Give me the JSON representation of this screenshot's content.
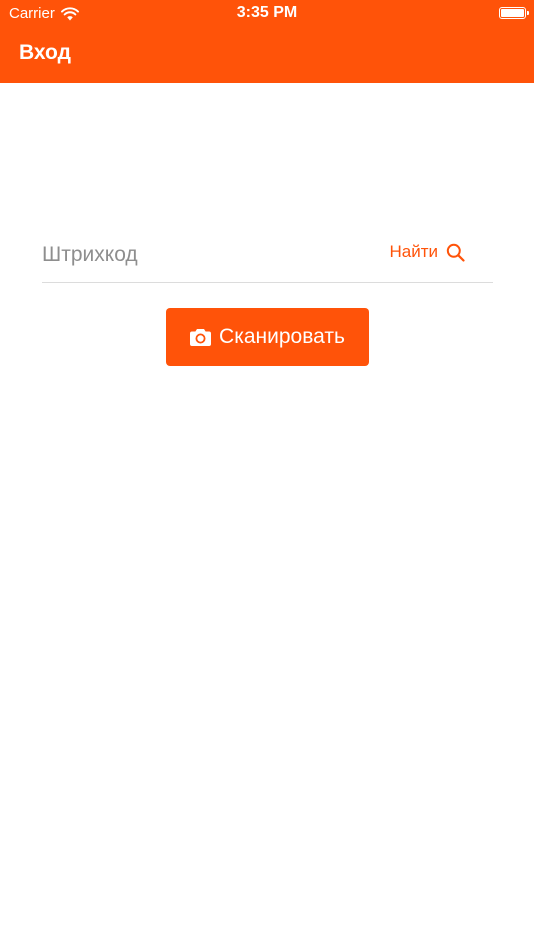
{
  "status_bar": {
    "carrier": "Carrier",
    "time": "3:35 PM",
    "icons": [
      "wifi-icon",
      "battery-icon"
    ]
  },
  "nav": {
    "title": "Вход"
  },
  "barcode": {
    "placeholder": "Штрихкод",
    "value": "",
    "find_label": "Найти",
    "find_icon": "search-icon"
  },
  "scan": {
    "label": "Сканировать",
    "icon": "camera-icon"
  },
  "colors": {
    "accent": "#FF5309",
    "background": "#FFFFFF",
    "placeholder": "#8E8E8E",
    "divider": "#DCDCDC"
  }
}
